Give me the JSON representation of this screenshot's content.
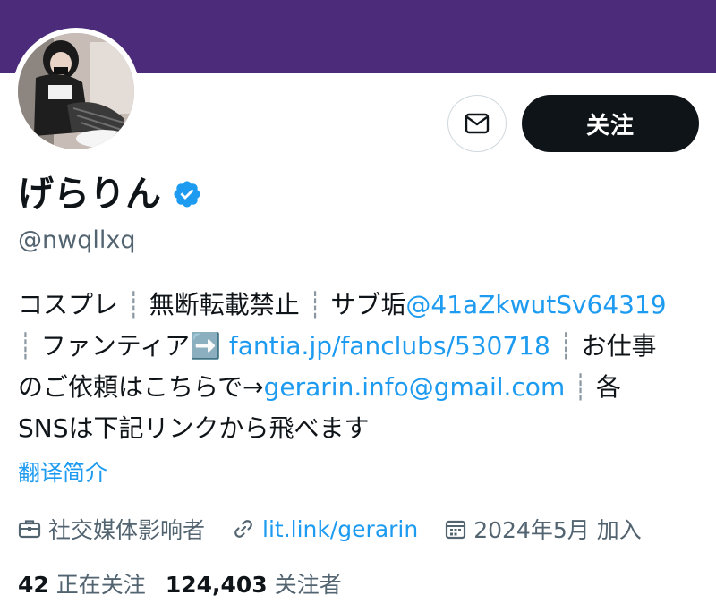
{
  "colors": {
    "banner": "#4b2b7a",
    "link": "#1d9bf0",
    "verified": "#1d9bf0",
    "follow_button_bg": "#0f1419",
    "secondary_text": "#536471"
  },
  "profile": {
    "display_name": "げらりん",
    "verified_icon": "verified-badge-icon",
    "handle": "@nwqllxq"
  },
  "actions": {
    "message_icon": "mail-icon",
    "follow_label": "关注"
  },
  "bio": {
    "line1_text": "コスプレ",
    "line1_sep1": "┊",
    "line1_text2": "無断転載禁止",
    "line1_sep2": "┊",
    "line1_text3": "サブ垢",
    "line1_mention": "@41aZkwutSv64319",
    "line2_sep1": "┊",
    "line2_text": "ファンティア",
    "line2_arrow": "➡️",
    "line2_link": "fantia.jp/fanclubs/530718",
    "line2_sep2": "┊",
    "line2_text2": "お仕事",
    "line3_text": "のご依頼はこちらで→",
    "line3_email": "gerarin.info@gmail.com",
    "line3_sep": "┊",
    "line3_text2": "各",
    "line4_text": "SNSは下記リンクから飛べます"
  },
  "translate_label": "翻译简介",
  "meta": {
    "category_icon": "briefcase-icon",
    "category": "社交媒体影响者",
    "link_icon": "link-icon",
    "link": "lit.link/gerarin",
    "joined_icon": "calendar-icon",
    "joined": "2024年5月 加入"
  },
  "stats": {
    "following_count": "42",
    "following_label": "正在关注",
    "followers_count": "124,403",
    "followers_label": "关注者"
  }
}
